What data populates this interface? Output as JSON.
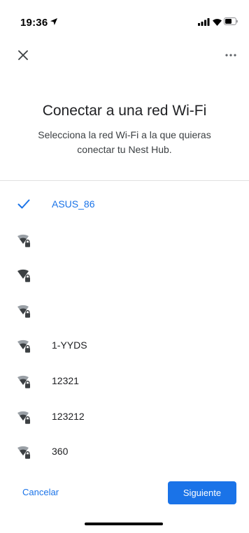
{
  "status_bar": {
    "time": "19:36"
  },
  "header": {
    "title": "Conectar a una red Wi-Fi",
    "subtitle": "Selecciona la red Wi-Fi a la que quieras conectar tu Nest Hub."
  },
  "networks": [
    {
      "name": "ASUS_86",
      "selected": true,
      "icon": "check-icon"
    },
    {
      "name": "",
      "selected": false,
      "icon": "wifi-lock-icon",
      "strength": "medium"
    },
    {
      "name": "",
      "selected": false,
      "icon": "wifi-lock-icon",
      "strength": "full"
    },
    {
      "name": "",
      "selected": false,
      "icon": "wifi-lock-icon",
      "strength": "medium"
    },
    {
      "name": "1-YYDS",
      "selected": false,
      "icon": "wifi-lock-icon",
      "strength": "medium"
    },
    {
      "name": "12321",
      "selected": false,
      "icon": "wifi-lock-icon",
      "strength": "medium"
    },
    {
      "name": "123212",
      "selected": false,
      "icon": "wifi-lock-icon",
      "strength": "medium"
    },
    {
      "name": "360",
      "selected": false,
      "icon": "wifi-lock-icon",
      "strength": "medium"
    }
  ],
  "footer": {
    "cancel_label": "Cancelar",
    "next_label": "Siguiente"
  },
  "colors": {
    "accent": "#1a73e8",
    "text": "#202124",
    "divider": "#e0e0e0",
    "icon_strong": "#3c4043",
    "icon_weak": "#9aa0a6"
  }
}
